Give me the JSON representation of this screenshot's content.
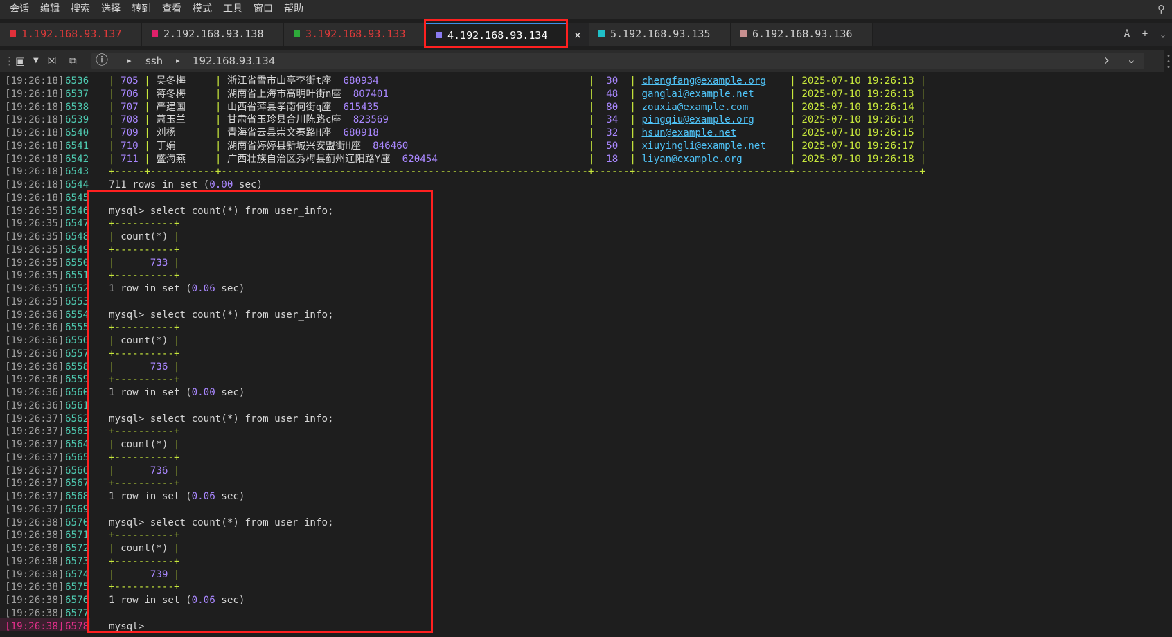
{
  "menu": [
    "会话",
    "编辑",
    "搜索",
    "选择",
    "转到",
    "查看",
    "模式",
    "工具",
    "窗口",
    "帮助"
  ],
  "search_icon": "search-icon",
  "tabs": [
    {
      "label": "1.192.168.93.137",
      "color": "#e0303a",
      "text_color": "#e03a3a"
    },
    {
      "label": "2.192.168.93.138",
      "color": "#e0206a",
      "text_color": "#d4d4d4"
    },
    {
      "label": "3.192.168.93.133",
      "color": "#2eaa3a",
      "text_color": "#e03a3a"
    },
    {
      "label": "4.192.168.93.134",
      "color": "#8a7af0",
      "text_color": "#ffffff"
    },
    {
      "label": "5.192.168.93.135",
      "color": "#20c0c8",
      "text_color": "#d4d4d4"
    },
    {
      "label": "6.192.168.93.136",
      "color": "#c89090",
      "text_color": "#d4d4d4"
    }
  ],
  "tab_close": "×",
  "tab_right": {
    "a": "A",
    "plus": "+",
    "chev": "⌄"
  },
  "toolbar": {
    "info": "ⓘ",
    "arrow1": "▸",
    "proto": "ssh",
    "arrow2": "▸",
    "host": "192.168.93.134",
    "chev_right": "›",
    "chev_down": "⌄"
  },
  "table_rows": [
    {
      "ts": "[19:26:18]",
      "ln": "6536",
      "id": "705",
      "name": "吴冬梅",
      "addr": "浙江省雪市山亭李街t座",
      "zip": "680934",
      "age": "30",
      "email": "chengfang@example.org",
      "dt": "2025-07-10 19:26:13"
    },
    {
      "ts": "[19:26:18]",
      "ln": "6537",
      "id": "706",
      "name": "蒋冬梅",
      "addr": "湖南省上海市高明叶街n座",
      "zip": "807401",
      "age": "48",
      "email": "ganglai@example.net",
      "dt": "2025-07-10 19:26:13"
    },
    {
      "ts": "[19:26:18]",
      "ln": "6538",
      "id": "707",
      "name": "严建国",
      "addr": "山西省萍县孝南何街q座",
      "zip": "615435",
      "age": "80",
      "email": "zouxia@example.com",
      "dt": "2025-07-10 19:26:14"
    },
    {
      "ts": "[19:26:18]",
      "ln": "6539",
      "id": "708",
      "name": "萧玉兰",
      "addr": "甘肃省玉珍县合川陈路c座",
      "zip": "823569",
      "age": "34",
      "email": "pingqiu@example.org",
      "dt": "2025-07-10 19:26:14"
    },
    {
      "ts": "[19:26:18]",
      "ln": "6540",
      "id": "709",
      "name": "刘杨",
      "addr": "青海省云县崇文秦路H座",
      "zip": "680918",
      "age": "32",
      "email": "hsun@example.net",
      "dt": "2025-07-10 19:26:15"
    },
    {
      "ts": "[19:26:18]",
      "ln": "6541",
      "id": "710",
      "name": "丁娟",
      "addr": "湖南省婷婷县新城兴安盟街H座",
      "zip": "846460",
      "age": "50",
      "email": "xiuyingli@example.net",
      "dt": "2025-07-10 19:26:17"
    },
    {
      "ts": "[19:26:18]",
      "ln": "6542",
      "id": "711",
      "name": "盛海燕",
      "addr": "广西壮族自治区秀梅县蓟州辽阳路Y座",
      "zip": "620454",
      "age": "18",
      "email": "liyan@example.org",
      "dt": "2025-07-10 19:26:18"
    }
  ],
  "table_border": "+-----+-----------+--------------------------------------------------------------+------+--------------------------+---------------------+",
  "rows_in_set": {
    "prefix": "711 rows in set (",
    "time": "0.00",
    "suffix": " sec)"
  },
  "queries": [
    {
      "ts": "[19:26:35]",
      "start": 6546,
      "count": "733",
      "time": "0.06"
    },
    {
      "ts": "[19:26:36]",
      "start": 6554,
      "count": "736",
      "time": "0.00"
    },
    {
      "ts": "[19:26:37]",
      "start": 6562,
      "count": "736",
      "time": "0.06"
    },
    {
      "ts": "[19:26:38]",
      "start": 6570,
      "count": "739",
      "time": "0.06"
    }
  ],
  "sql": {
    "prompt": "mysql>",
    "cmd": " select count(*) from user_info;",
    "border": "+----------+",
    "header": "| count(*) |",
    "row_prefix": "|      ",
    "row_suffix": " |",
    "result_prefix": "1 row in set (",
    "result_suffix": " sec)"
  },
  "first_ts": {
    "ts": "[19:26:18]",
    "ln": "6545"
  },
  "last_line": {
    "ts": "[19:26:38]",
    "ln": "6578",
    "text": "mysql>"
  }
}
